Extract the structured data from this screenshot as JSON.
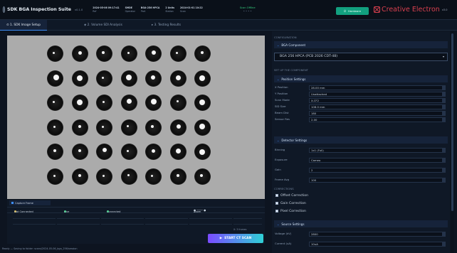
{
  "header": {
    "title": "SDK BGA Inspection Suite",
    "version": "v0.1.0",
    "meta": [
      {
        "label": "Ref",
        "value": "2024-05-06 09:17:41"
      },
      {
        "label": "Operator",
        "value": "SMDE"
      },
      {
        "label": "Part",
        "value": "BGA-256 HPCA"
      },
      {
        "label": "Station",
        "value": "2 Units"
      },
      {
        "label": "Scan",
        "value": "2024-01-01 10:22"
      }
    ],
    "status_title": "Scan Offline",
    "status_sub": "• • • •",
    "hardware_label": "Hardware",
    "logo_text": "Creative Electron",
    "logo_tm": "v3.0"
  },
  "tabs": [
    {
      "label": "1. SDK Image Setup"
    },
    {
      "label": "2. Volume SDI Analysis"
    },
    {
      "label": "3. Testing Results"
    }
  ],
  "capture": {
    "header": "Capture Frame",
    "conn_items": [
      {
        "label": "Not Connected",
        "color": "#e1b83a"
      },
      {
        "label": "Live",
        "color": "#35d07f"
      },
      {
        "label": "Connected",
        "color": "#35d07f"
      }
    ],
    "zoom_label": "Zoom",
    "start_button": "START CT SCAN",
    "scan_label": "X: 3 frames"
  },
  "footer_text": "Ready — Saving to folder: scans/2024-05-06_bga_256/session",
  "right": {
    "configuration_label": "CONFIGURATION",
    "bga_component_header": "BGA Component",
    "bga_component_value": "BGA 256 HPCA (PCB 2026 CDT-48)",
    "set_label": "SET UP THE COMPONENT",
    "position_header": "Position Settings",
    "position_fields": [
      {
        "label": "X Position",
        "value": "28.00 mm"
      },
      {
        "label": "Y Position",
        "value": "Unattached"
      },
      {
        "label": "Scan Mode",
        "value": "X-CF2"
      },
      {
        "label": "SID Size",
        "value": "108.0 mm"
      },
      {
        "label": "Beam Dist",
        "value": "180"
      },
      {
        "label": "Sensor Res",
        "value": "2.00"
      }
    ],
    "detector_header": "Detector Settings",
    "detector_fields": [
      {
        "label": "Binning",
        "value": "1x1 (Full)"
      },
      {
        "label": "Exposure",
        "value": "Cameo"
      },
      {
        "label": "Gain",
        "value": "2"
      },
      {
        "label": "Frame Avg",
        "value": "100"
      }
    ],
    "corrections_label": "CORRECTIONS",
    "checks": [
      {
        "label": "Offset Correction"
      },
      {
        "label": "Gain Correction"
      },
      {
        "label": "Pixel Correction"
      }
    ],
    "source_header": "Source Settings",
    "source_fields": [
      {
        "label": "Voltage (kV)",
        "value": "2800"
      },
      {
        "label": "Current (uA)",
        "value": "10uA"
      }
    ]
  }
}
